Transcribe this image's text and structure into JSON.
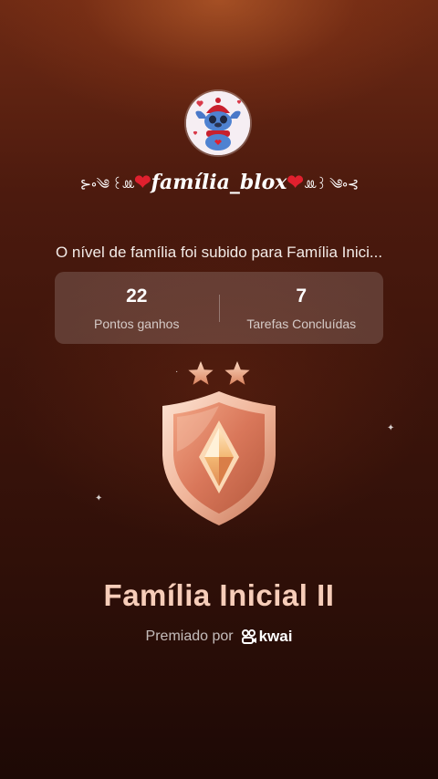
{
  "profile": {
    "username": "família_blox",
    "deco_left": "⊱∘༄ ꒰ꔛ",
    "deco_right": "ꔛ꒱ ༄∘⊰"
  },
  "level_message": "O nível de família foi subido para Família Inici...",
  "stats": [
    {
      "value": "22",
      "label": "Pontos ganhos"
    },
    {
      "value": "7",
      "label": "Tarefas Concluídas"
    }
  ],
  "badge": {
    "stars": 2,
    "title": "Família Inicial II",
    "colors": {
      "shield": "#e8a489",
      "gem": "#f3b873",
      "title": "#f7cdb9"
    }
  },
  "awarded": {
    "prefix": "Premiado por",
    "brand": "kwai"
  }
}
